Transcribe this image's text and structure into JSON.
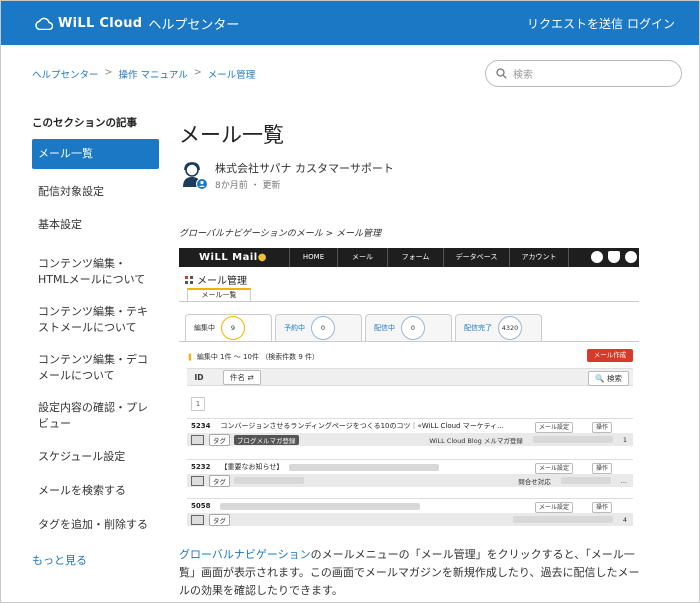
{
  "header": {
    "brand": "WiLL Cloud",
    "help_center": "ヘルプセンター",
    "request": "リクエストを送信",
    "login": "ログイン"
  },
  "breadcrumb": [
    "ヘルプセンター",
    "操作 マニュアル",
    "メール管理"
  ],
  "search": {
    "placeholder": "検索"
  },
  "sidebar": {
    "title": "このセクションの記事",
    "items": [
      "メール一覧",
      "配信対象設定",
      "基本設定",
      "コンテンツ編集・HTMLメールについて",
      "コンテンツ編集・テキストメールについて",
      "コンテンツ編集・デコメールについて",
      "設定内容の確認・プレビュー",
      "スケジュール設定",
      "メールを検索する",
      "タグを追加・削除する"
    ],
    "more": "もっと見る"
  },
  "article": {
    "title": "メール一覧",
    "author": "株式会社サパナ カスタマーサポート",
    "meta_time": "8か月前",
    "meta_sep": "・",
    "meta_updated": "更新",
    "nav_path": "グローバルナビゲーションのメール > メール管理",
    "para_link": "グローバルナビゲーション",
    "para_text": "のメールメニューの「メール管理」をクリックすると、「メール一覧」画面が表示されます。この画面でメールマガジンを新規作成したり、過去に配信したメールの効果を確認したりできます。"
  },
  "shot": {
    "logo": "WiLL Mail",
    "nav": [
      "HOME",
      "メール",
      "フォーム",
      "データベース",
      "アカウント"
    ],
    "page_title": "メール管理",
    "tab": "メール一覧",
    "status": [
      {
        "label": "編集中",
        "count": "9"
      },
      {
        "label": "予約中",
        "count": "0"
      },
      {
        "label": "配信中",
        "count": "0"
      },
      {
        "label": "配信完了",
        "count": "4320"
      }
    ],
    "editing_info": "編集中  1件 ～ 10件  （検索件数 9 件）",
    "new_button": "メール作成",
    "col_id": "ID",
    "col_name": "件名",
    "search_button": "検索",
    "page": "1",
    "rows": [
      {
        "id": "5234",
        "subject": "コンバージョンさせるランディングページをつくる10のコツ｜«WiLL Cloud マーケティ...",
        "tag": "タグ",
        "tag2": "ブログメルマガ登録",
        "list": "WiLL Cloud Blog メルマガ登録",
        "count": "1"
      },
      {
        "id": "5232",
        "subject": "【重要なお知らせ】",
        "tag": "タグ",
        "tag2": "",
        "list": "問合せ対応",
        "count": "..."
      },
      {
        "id": "5058",
        "subject": "",
        "tag": "タグ",
        "tag2": "",
        "list": "",
        "count": "4"
      }
    ],
    "settings_btn": "メール設定",
    "ops_btn": "操作"
  },
  "colors": {
    "accent": "#1a78c4",
    "danger": "#d43b2a",
    "highlight": "#f0b400"
  }
}
